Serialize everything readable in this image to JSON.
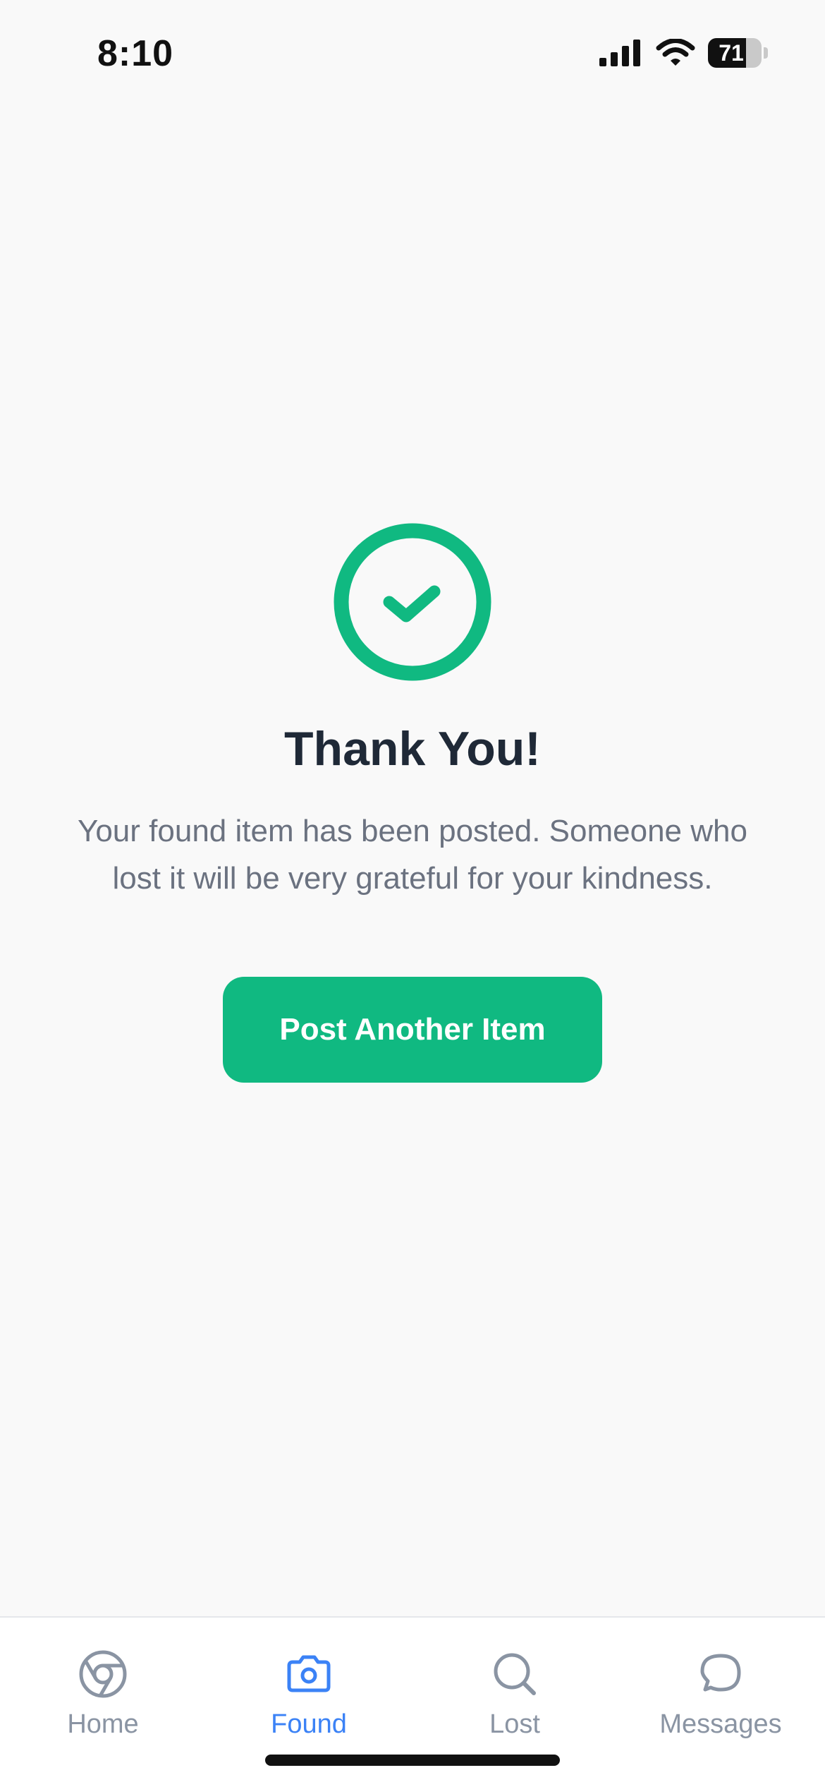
{
  "status_bar": {
    "time": "8:10",
    "battery_level": "71",
    "battery_fraction": 0.71
  },
  "success": {
    "icon": "check-circle-icon",
    "title": "Thank You!",
    "message": "Your found item has been posted. Someone who lost it will be very grateful for your kindness.",
    "button_label": "Post Another Item"
  },
  "tab_bar": {
    "tabs": [
      {
        "label": "Home",
        "icon": "chrome-icon",
        "active": false
      },
      {
        "label": "Found",
        "icon": "camera-icon",
        "active": true
      },
      {
        "label": "Lost",
        "icon": "search-icon",
        "active": false
      },
      {
        "label": "Messages",
        "icon": "message-bubble-icon",
        "active": false
      }
    ]
  },
  "colors": {
    "accent_green": "#10b981",
    "active_tab_blue": "#3b82f6",
    "inactive_tab_gray": "#8a94a3",
    "title_text": "#1f2937",
    "body_text": "#6b7280",
    "background": "#f9f9f9"
  }
}
